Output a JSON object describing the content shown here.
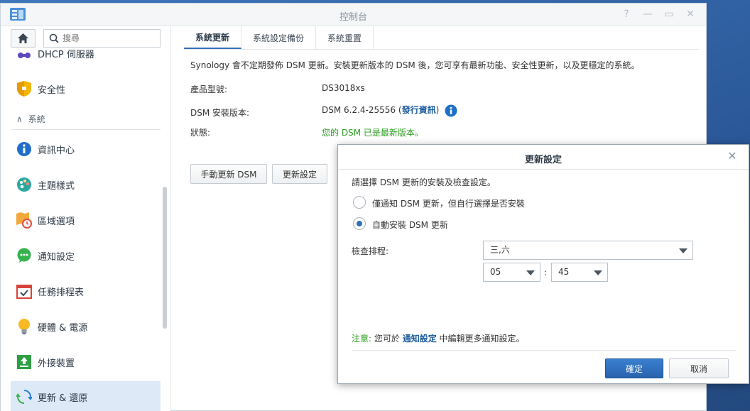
{
  "window": {
    "title": "控制台"
  },
  "sidebar": {
    "search_placeholder": "搜尋",
    "items": [
      {
        "label": "DHCP 伺服器"
      },
      {
        "label": "安全性"
      },
      {
        "label": "資訊中心"
      },
      {
        "label": "主題樣式"
      },
      {
        "label": "區域選項"
      },
      {
        "label": "通知設定"
      },
      {
        "label": "任務排程表"
      },
      {
        "label": "硬體 & 電源"
      },
      {
        "label": "外接裝置"
      },
      {
        "label": "更新 & 還原"
      }
    ],
    "section_system": "系統"
  },
  "tabs": [
    {
      "label": "系統更新"
    },
    {
      "label": "系統設定備份"
    },
    {
      "label": "系統重置"
    }
  ],
  "main": {
    "intro": "Synology 會不定期發佈 DSM 更新。安裝更新版本的 DSM 後，您可享有最新功能、安全性更新，以及更穩定的系統。",
    "model_label": "產品型號:",
    "model_value": "DS3018xs",
    "version_label": "DSM 安裝版本:",
    "version_value": "DSM 6.2.4-25556 (",
    "release_link": "發行資訊",
    "version_suffix": ")",
    "status_label": "狀態:",
    "status_value": "您的 DSM 已是最新版本。",
    "manual_update_button": "手動更新 DSM",
    "update_settings_button": "更新設定"
  },
  "dialog": {
    "title": "更新設定",
    "instruction": "請選擇 DSM 更新的安裝及檢查設定。",
    "option_notify": "僅通知 DSM 更新，但自行選擇是否安裝",
    "option_auto": "自動安裝 DSM 更新",
    "selected_option": "auto",
    "schedule_label": "檢查排程:",
    "schedule_days": "三,六",
    "hour": "05",
    "time_separator": ":",
    "minute": "45",
    "note_label": "注意:",
    "note_before": " 您可於 ",
    "note_link": "通知設定",
    "note_after": " 中編輯更多通知設定。",
    "ok_button": "確定",
    "cancel_button": "取消"
  },
  "colors": {
    "accent": "#2f6fb8",
    "success_text": "#299e1e",
    "link": "#1c5c9e"
  },
  "icons": {
    "app": "control-panel-icon",
    "home": "home-icon",
    "search": "search-icon",
    "help": "help-icon",
    "minimize": "minimize-icon",
    "maximize": "maximize-icon",
    "close": "close-icon"
  }
}
